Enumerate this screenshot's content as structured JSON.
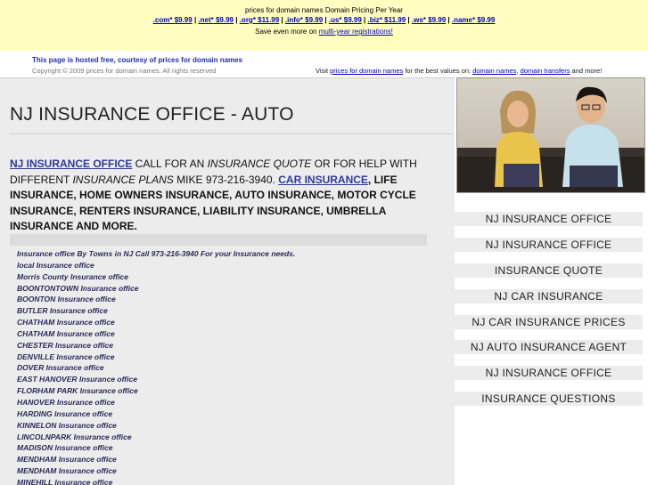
{
  "banner": {
    "title": "prices for domain names Domain Pricing Per Year",
    "prices": [
      {
        "tld": ".com*",
        "price": "$9.99"
      },
      {
        "tld": ".net*",
        "price": "$9.99"
      },
      {
        "tld": ".org*",
        "price": "$11.99"
      },
      {
        "tld": ".info*",
        "price": "$9.99"
      },
      {
        "tld": ".us*",
        "price": "$9.99"
      },
      {
        "tld": ".biz*",
        "price": "$11.99"
      },
      {
        "tld": ".ws*",
        "price": "$9.99"
      },
      {
        "tld": ".name*",
        "price": "$9.99"
      }
    ],
    "save_prefix": "Save even more on ",
    "save_link": "multi-year registrations!"
  },
  "hosting": {
    "hosted_text": "This page is hosted free, courtesy of prices for domain names",
    "copyright": "Copyright © 2009 prices for domain names. All rights reserved",
    "visit_prefix": "Visit ",
    "visit_link": "prices for domain names",
    "visit_middle": " for the best values on: ",
    "link_domain_names": "domain names",
    "visit_comma": ", ",
    "link_domain_transfers": "domain transfers",
    "visit_suffix": " and more!"
  },
  "main": {
    "title": "NJ INSURANCE OFFICE - AUTO",
    "intro": {
      "link1": "NJ INSURANCE OFFICE",
      "t1": " CALL FOR AN ",
      "i1": "INSURANCE QUOTE",
      "t2": " OR FOR HELP WITH DIFFERENT ",
      "i2": "INSURANCE PLANS",
      "t3": " MIKE 973-216-3940.  ",
      "link2": "CAR INSURANCE",
      "b1": ", LIFE INSURANCE, HOME OWNERS INSURANCE, AUTO INSURANCE, MOTOR CYCLE INSURANCE, RENTERS INSURANCE, LIABILITY INSURANCE, UMBRELLA INSURANCE AND MORE."
    },
    "offices": [
      "Insurance office By Towns in NJ  Call 973-216-3940 For your Insurance needs.",
      "local Insurance office",
      "Morris County Insurance office",
      "BOONTONTOWN Insurance office",
      "BOONTON Insurance office",
      "BUTLER Insurance office",
      "CHATHAM Insurance office",
      "CHATHAM Insurance office",
      "CHESTER Insurance office",
      "DENVILLE Insurance office",
      "DOVER Insurance office",
      "EAST HANOVER Insurance office",
      "FLORHAM PARK Insurance office",
      "HANOVER Insurance office",
      "HARDING Insurance office",
      "KINNELON Insurance office",
      "LINCOLNPARK Insurance office",
      "MADISON Insurance office",
      "MENDHAM Insurance office",
      "MENDHAM Insurance office",
      "MINEHILL Insurance office"
    ]
  },
  "sidebar": {
    "photo_icon": "couple-photo",
    "nav": [
      "NJ INSURANCE OFFICE",
      "NJ INSURANCE OFFICE",
      "INSURANCE QUOTE",
      "NJ CAR INSURANCE",
      "NJ CAR INSURANCE PRICES",
      "NJ AUTO INSURANCE AGENT",
      "NJ INSURANCE OFFICE",
      "INSURANCE QUESTIONS"
    ]
  },
  "colors": {
    "banner_bg": "#fffdc0",
    "link": "#0000cc",
    "hosted_text": "#1f2fb8",
    "main_bg": "#ececec"
  }
}
